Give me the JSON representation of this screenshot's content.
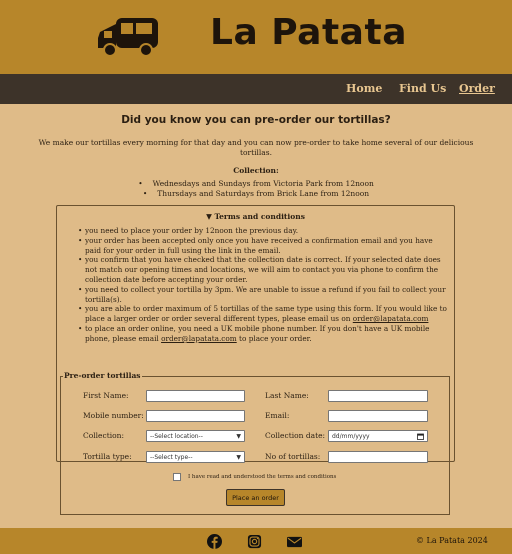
{
  "header": {
    "brand": "La Patata",
    "logo_icon": "food-truck-icon"
  },
  "nav": {
    "items": [
      "Home",
      "Find Us",
      "Order"
    ],
    "active": "Order"
  },
  "main": {
    "question": "Did you know you can pre-order our tortillas?",
    "intro": "We make our tortillas every morning for that day and you can now pre-order to take home several of our delicious tortillas.",
    "collection_heading": "Collection:",
    "collection_items": [
      "Wednesdays and Sundays from Victoria Park from 12noon",
      "Thursdays and Saturdays from Brick Lane from 12noon"
    ]
  },
  "terms": {
    "summary": "▼ Terms and conditions",
    "items": [
      "you need to place your order by 12noon the previous day.",
      "your order has been accepted only once you have received a confirmation email and you have paid for your order in full using the link in the email.",
      "you confirm that you have checked that the collection date is correct. If your selected date does not match our opening times and locations, we will aim to contact you via phone to confirm the collection date before accepting your order.",
      "you need to collect your tortilla by 3pm. We are unable to issue a refund if you fail to collect your tortilla(s).",
      "you are able to order maximum of 5 tortillas of the same type using this form. If you would like to place a larger order or order several different types, please email us on",
      "to place an order online, you need a UK mobile phone number. If you don't have a UK mobile phone, please email"
    ],
    "email": "order@lapatata.com",
    "last_suffix": "to place your order."
  },
  "form": {
    "legend": "Pre-order tortillas",
    "first_name_label": "First Name:",
    "last_name_label": "Last Name:",
    "mobile_label": "Mobile number:",
    "email_label": "Email:",
    "collection_label": "Collection:",
    "collection_select": "--Select location--",
    "collection_date_label": "Collection date:",
    "date_placeholder": "dd/mm/yyyy",
    "type_label": "Tortilla type:",
    "type_select": "--Select type--",
    "qty_label": "No of tortillas:",
    "checkbox_label": "I have read and understood the terms and conditions",
    "submit": "Place an order"
  },
  "footer": {
    "icons": [
      "facebook-icon",
      "instagram-icon",
      "envelope-icon"
    ],
    "copyright": "© La Patata 2024"
  },
  "colors": {
    "header": "#b7862a",
    "nav": "#3d3329",
    "background": "#dfbb88"
  }
}
